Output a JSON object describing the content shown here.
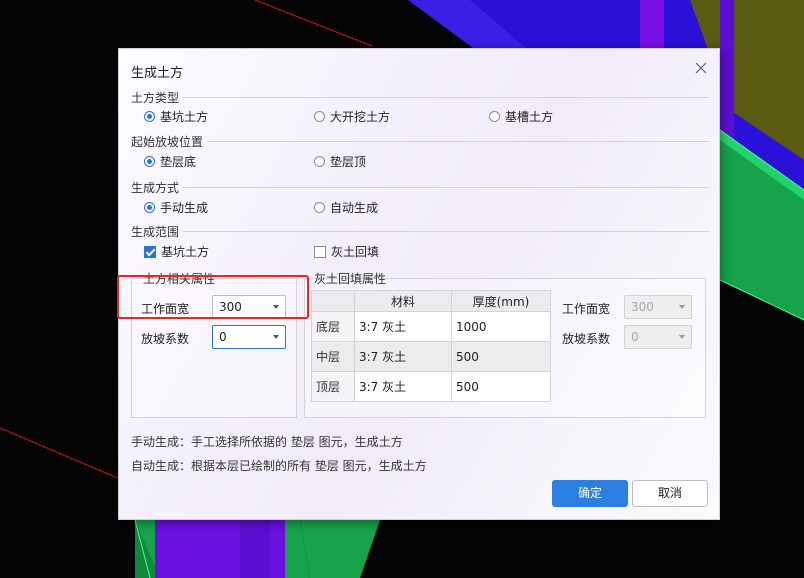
{
  "dialog": {
    "title": "生成土方",
    "sections": {
      "earthwork_type": {
        "label": "土方类型",
        "options": [
          "基坑土方",
          "大开挖土方",
          "基槽土方"
        ],
        "selected": 0
      },
      "slope_start": {
        "label": "起始放坡位置",
        "options": [
          "垫层底",
          "垫层顶"
        ],
        "selected": 0
      },
      "generate_mode": {
        "label": "生成方式",
        "options": [
          "手动生成",
          "自动生成"
        ],
        "selected": 0
      },
      "generate_scope": {
        "label": "生成范围",
        "options": [
          {
            "label": "基坑土方",
            "checked": true
          },
          {
            "label": "灰土回填",
            "checked": false
          }
        ]
      }
    },
    "earthwork_props": {
      "title": "土方相关属性",
      "work_width_label": "工作面宽",
      "work_width_value": "300",
      "slope_factor_label": "放坡系数",
      "slope_factor_value": "0"
    },
    "backfill_props": {
      "title": "灰土回填属性",
      "table": {
        "headers": [
          "",
          "材料",
          "厚度(mm)"
        ],
        "rows": [
          {
            "name": "底层",
            "material": "3:7 灰土",
            "thickness": "1000"
          },
          {
            "name": "中层",
            "material": "3:7 灰土",
            "thickness": "500"
          },
          {
            "name": "顶层",
            "material": "3:7 灰土",
            "thickness": "500"
          }
        ]
      },
      "work_width_label": "工作面宽",
      "work_width_value": "300",
      "slope_factor_label": "放坡系数",
      "slope_factor_value": "0"
    },
    "hints": [
      "手动生成：手工选择所依据的 垫层 图元，生成土方",
      "自动生成：根据本层已绘制的所有 垫层 图元，生成土方"
    ],
    "buttons": {
      "ok": "确定",
      "cancel": "取消"
    }
  },
  "colors": {
    "accent": "#2a7fe0",
    "highlight": "#e8262a",
    "viewport_blue": "#2a10d8",
    "viewport_purple": "#7a10e6",
    "viewport_green": "#16a34a",
    "viewport_olive": "#5a5a10"
  }
}
